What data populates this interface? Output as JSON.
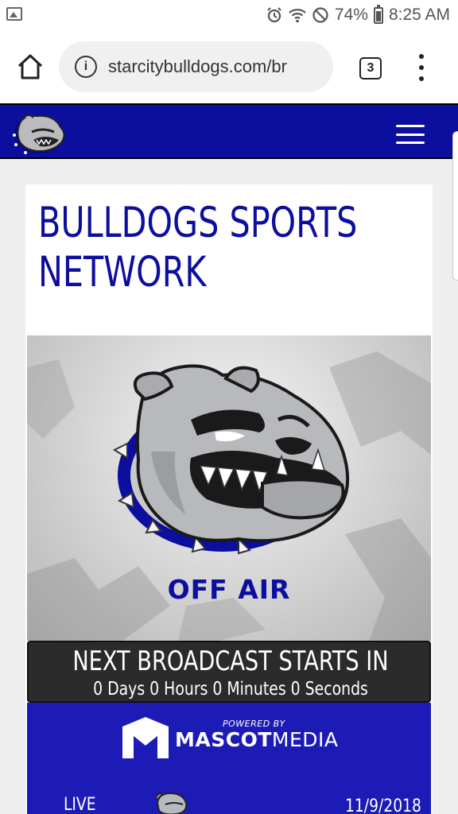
{
  "status_bar": {
    "battery": "74%",
    "time": "8:25 AM",
    "icons": [
      "gallery-icon",
      "alarm-icon",
      "wifi-icon",
      "do-not-disturb-icon",
      "battery-icon"
    ]
  },
  "browser": {
    "url": "starcitybulldogs.com/br",
    "tab_count": "3",
    "icons": [
      "home-icon",
      "info-icon",
      "tabs-icon",
      "overflow-menu-icon"
    ]
  },
  "site": {
    "header_color": "#0c0e9e",
    "logo": "bulldog-logo"
  },
  "page": {
    "title": "BULLDOGS SPORTS NETWORK",
    "player_status": "OFF AIR",
    "countdown_title": "NEXT BROADCAST STARTS IN",
    "countdown_value": "0 Days 0 Hours 0 Minutes 0 Seconds"
  },
  "sponsor": {
    "powered_by": "POWERED BY",
    "brand_bold": "MASCOT",
    "brand_light": "MEDIA"
  },
  "schedule": {
    "status": "LIVE",
    "date": "11/9/2018"
  },
  "colors": {
    "brand_blue": "#0c0e9e",
    "sponsor_blue": "#1d1bb5",
    "countdown_bg": "#2b2b2b"
  }
}
